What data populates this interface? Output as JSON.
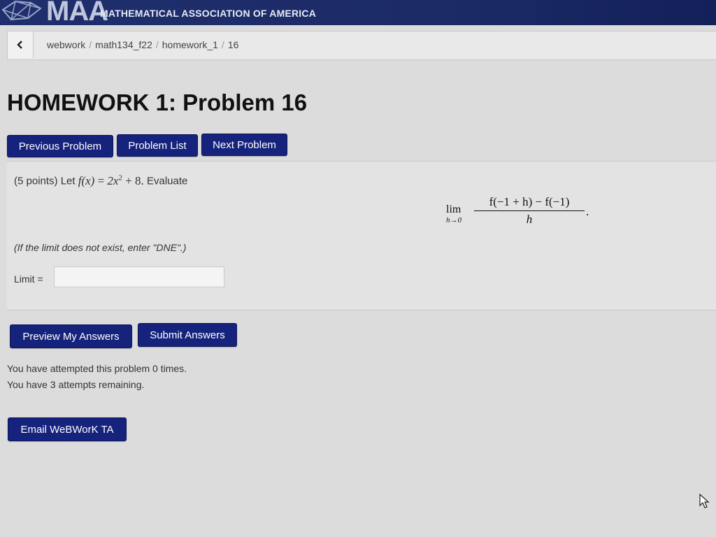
{
  "header": {
    "logo_text": "MAA",
    "org_name": "MATHEMATICAL ASSOCIATION OF AMERICA",
    "bar_color": "#1f2f6e"
  },
  "breadcrumb": {
    "back_icon": "chevron-left-icon",
    "items": [
      "webwork",
      "math134_f22",
      "homework_1",
      "16"
    ]
  },
  "page_title": "HOMEWORK 1: Problem 16",
  "nav_buttons": {
    "previous": "Previous Problem",
    "list": "Problem List",
    "next": "Next Problem"
  },
  "problem": {
    "points": "(5 points) Let",
    "function_lhs": "f(x)",
    "function_rhs": "2x",
    "exponent": "2",
    "function_tail": "+ 8.",
    "evaluate": "Evaluate",
    "limit_word": "lim",
    "limit_sub": "h→0",
    "numerator": "f(−1 + h) − f(−1)",
    "denominator": "h",
    "period": ".",
    "hint": "(If the limit does not exist, enter \"DNE\".)",
    "limit_label": "Limit =",
    "limit_value": ""
  },
  "actions": {
    "preview": "Preview My Answers",
    "submit": "Submit Answers"
  },
  "attempts": {
    "attempted": "You have attempted this problem 0 times.",
    "remaining": "You have 3 attempts remaining."
  },
  "email_button": "Email WeBWorK TA",
  "colors": {
    "button_bg": "#16237c",
    "page_bg": "#dcdcdc"
  }
}
